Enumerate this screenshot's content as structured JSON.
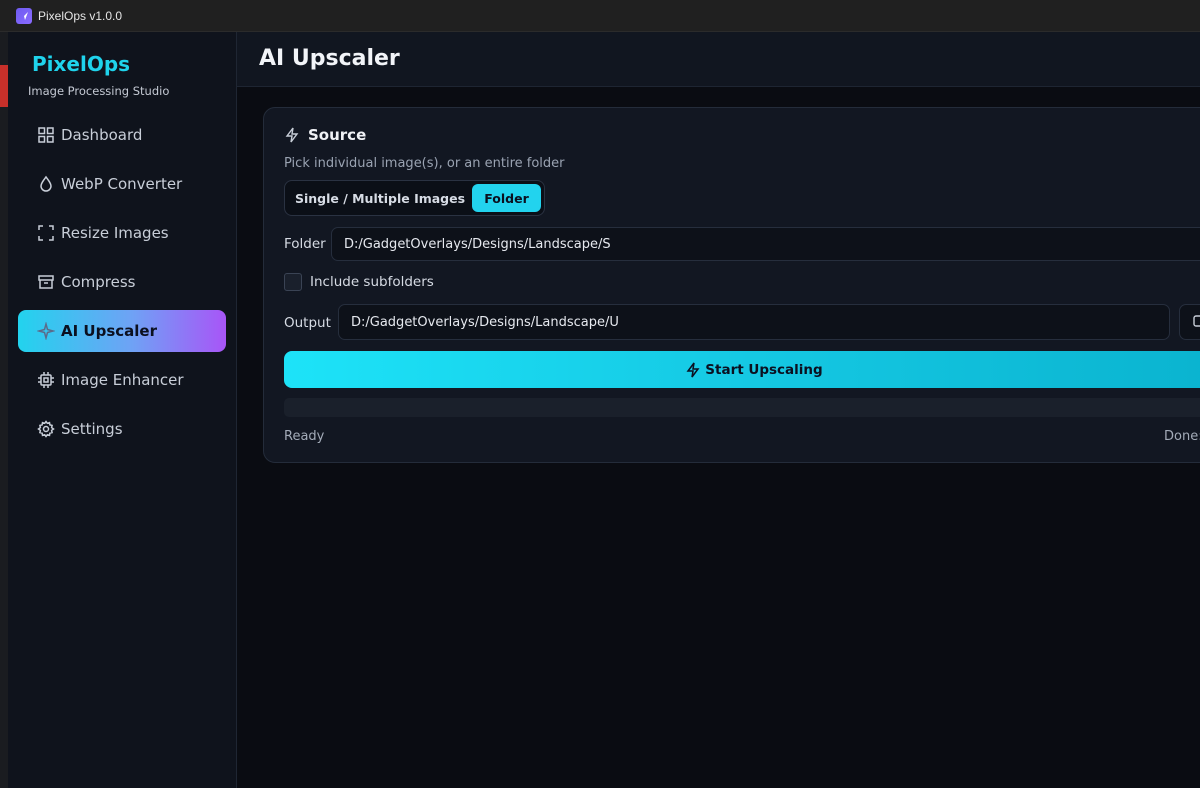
{
  "titlebar": {
    "title": "PixelOps v1.0.0"
  },
  "sidebar": {
    "brand": "PixelOps",
    "subtitle": "Image Processing Studio",
    "items": [
      {
        "label": "Dashboard",
        "icon": "grid-icon"
      },
      {
        "label": "WebP Converter",
        "icon": "droplet-icon"
      },
      {
        "label": "Resize Images",
        "icon": "crop-frame-icon"
      },
      {
        "label": "Compress",
        "icon": "archive-icon"
      },
      {
        "label": "AI Upscaler",
        "icon": "sparkle-icon",
        "active": true
      },
      {
        "label": "Image Enhancer",
        "icon": "chip-icon"
      },
      {
        "label": "Settings",
        "icon": "gear-icon"
      }
    ]
  },
  "header": {
    "title": "AI Upscaler"
  },
  "source": {
    "title": "Source",
    "subtitle": "Pick individual image(s), or an entire folder",
    "mode_single": "Single / Multiple Images",
    "mode_folder": "Folder",
    "selected_mode": "Folder",
    "folder_label": "Folder",
    "folder_value": "D:/GadgetOverlays/Designs/Landscape/S",
    "include_subfolders_label": "Include subfolders",
    "include_subfolders": false,
    "output_label": "Output",
    "output_value": "D:/GadgetOverlays/Designs/Landscape/U",
    "start_label": "Start Upscaling",
    "progress": 0,
    "status_left": "Ready",
    "status_right": "Done:"
  },
  "colors": {
    "accent": "#22d3ee",
    "accent_purple": "#a855f7",
    "background": "#0a0c12"
  }
}
